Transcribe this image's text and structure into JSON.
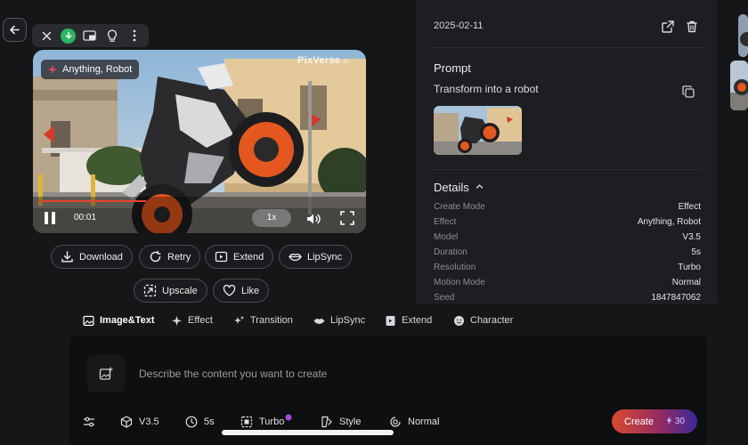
{
  "player": {
    "effect_chip": "Anything, Robot",
    "watermark": "PixVerse",
    "watermark_suffix": ".ai",
    "time": "00:01",
    "speed": "1x",
    "progress": 0.33
  },
  "actions": {
    "download": "Download",
    "retry": "Retry",
    "extend": "Extend",
    "lipsync": "LipSync",
    "upscale": "Upscale",
    "like": "Like"
  },
  "panel": {
    "date": "2025-02-11",
    "prompt_heading": "Prompt",
    "prompt_text": "Transform into a robot",
    "details_heading": "Details",
    "details": [
      {
        "label": "Create Mode",
        "value": "Effect"
      },
      {
        "label": "Effect",
        "value": "Anything, Robot"
      },
      {
        "label": "Model",
        "value": "V3.5"
      },
      {
        "label": "Duration",
        "value": "5s"
      },
      {
        "label": "Resolution",
        "value": "Turbo"
      },
      {
        "label": "Motion Mode",
        "value": "Normal"
      },
      {
        "label": "Seed",
        "value": "1847847062"
      }
    ]
  },
  "modes": [
    {
      "label": "Image&Text",
      "icon": "image-icon",
      "active": true
    },
    {
      "label": "Effect",
      "icon": "sparkle-icon"
    },
    {
      "label": "Transition",
      "icon": "transition-icon"
    },
    {
      "label": "LipSync",
      "icon": "lips-icon"
    },
    {
      "label": "Extend",
      "icon": "extend-icon"
    },
    {
      "label": "Character",
      "icon": "character-icon"
    }
  ],
  "composer": {
    "placeholder": "Describe the content you want to create",
    "model": "V3.5",
    "duration": "5s",
    "quality": "Turbo",
    "style": "Style",
    "motion": "Normal",
    "create_label": "Create",
    "create_cost": "30"
  },
  "colors": {
    "accent_green": "#2fb562",
    "create_gradient_start": "#d94a2e",
    "create_gradient_end": "#3a2a9a",
    "progress": "#e8432f"
  }
}
